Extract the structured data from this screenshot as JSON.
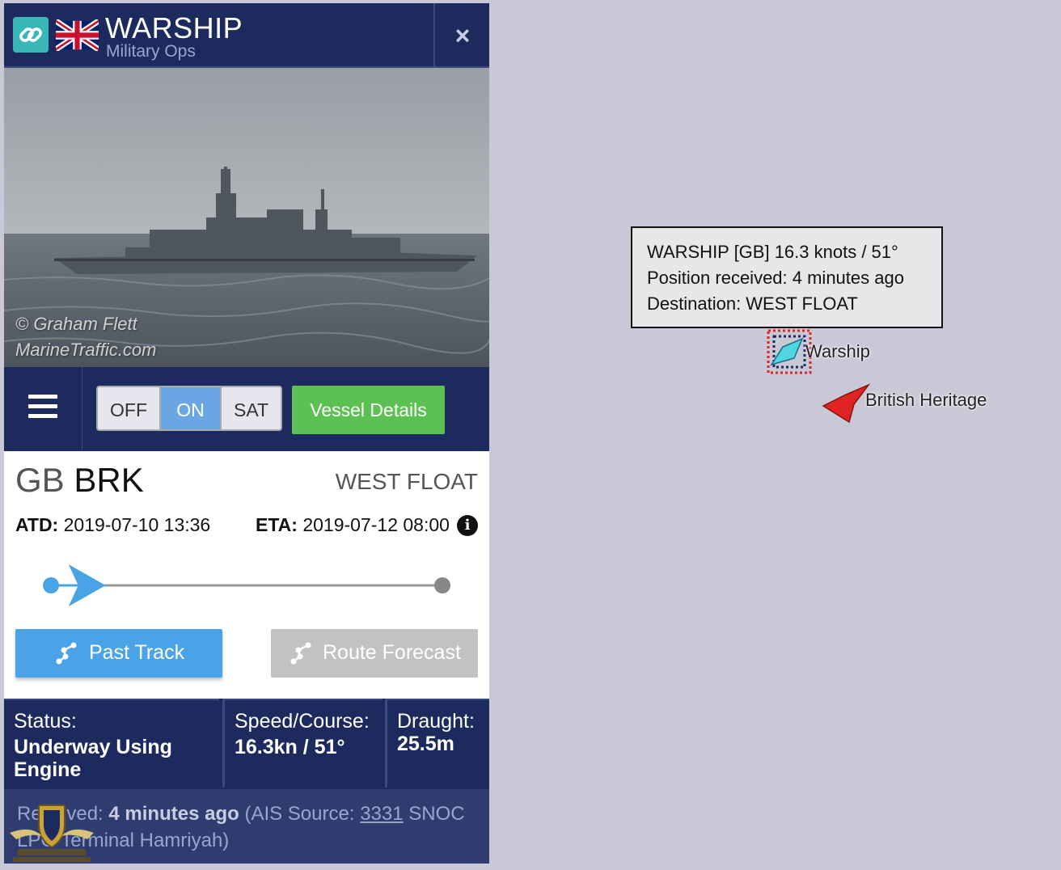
{
  "header": {
    "vessel_name": "WARSHIP",
    "vessel_type": "Military Ops",
    "close_glyph": "×"
  },
  "photo": {
    "credit_line1": "© Graham Flett",
    "credit_line2": "MarineTraffic.com"
  },
  "toolbar": {
    "modes": [
      "OFF",
      "ON",
      "SAT"
    ],
    "active_mode": "ON",
    "vessel_details_label": "Vessel Details"
  },
  "voyage": {
    "country_code": "GB",
    "port_code": "BRK",
    "destination": "WEST FLOAT",
    "atd_label": "ATD:",
    "atd_value": "2019-07-10 13:36",
    "eta_label": "ETA:",
    "eta_value": "2019-07-12 08:00",
    "progress": 0.14,
    "past_track_label": "Past Track",
    "route_forecast_label": "Route Forecast"
  },
  "stats": {
    "status_label": "Status:",
    "status_value_line1": "Underway Using",
    "status_value_line2": "Engine",
    "speed_label": "Speed/Course:",
    "speed_value": "16.3kn / 51°",
    "draught_label": "Draught:",
    "draught_value": "25.5m"
  },
  "received": {
    "prefix": "Received:",
    "ago": "4 minutes ago",
    "source_prefix": "(AIS Source:",
    "source_id": "3331",
    "source_name_1": "SNOC",
    "source_name_2": "LPG Terminal Hamriyah)"
  },
  "tooltip": {
    "line1": "WARSHIP [GB] 16.3 knots / 51°",
    "line2": "Position received: 4 minutes ago",
    "line3": "Destination: WEST FLOAT"
  },
  "map": {
    "selected_vessel_label": "Warship",
    "other_vessel_label": "British Heritage",
    "selected_color": "#4fd6e0",
    "other_color": "#e02424"
  },
  "colors": {
    "panel_navy": "#1d2a5e",
    "accent_blue": "#4aa3e6",
    "accent_green": "#5cc152",
    "map_bg": "#c8c8d6"
  }
}
